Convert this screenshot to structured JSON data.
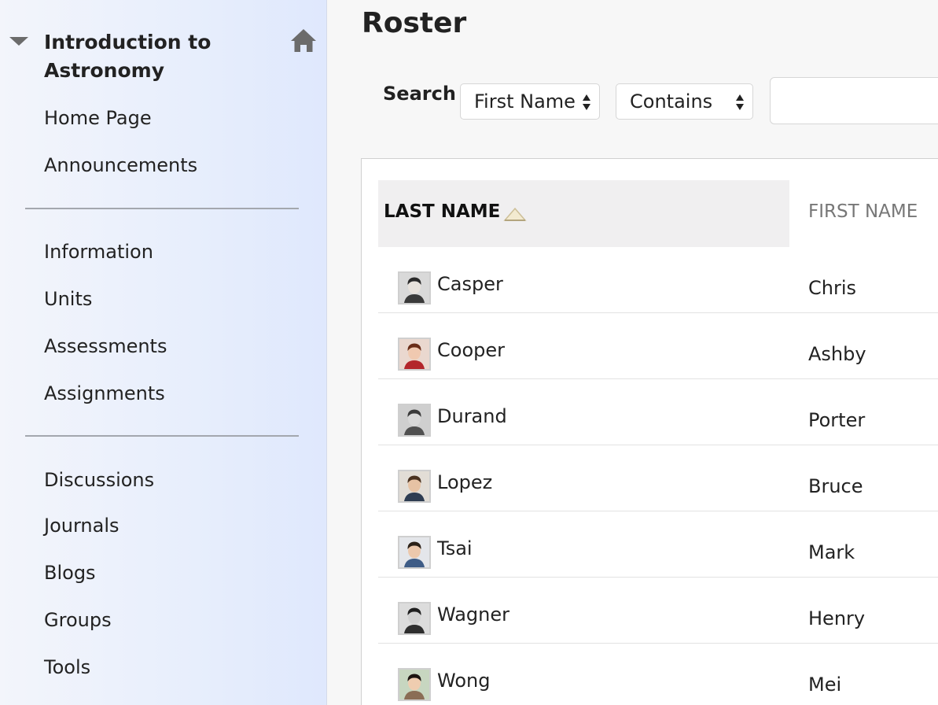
{
  "sidebar": {
    "course_title": "Introduction to Astronomy",
    "groups": [
      [
        "Home Page",
        "Announcements"
      ],
      [
        "Information",
        "Units",
        "Assessments",
        "Assignments"
      ],
      [
        "Discussions",
        "Journals",
        "Blogs",
        "Groups",
        "Tools"
      ]
    ]
  },
  "main": {
    "title": "Roster",
    "search": {
      "label": "Search",
      "field_value": "First Name",
      "operator_value": "Contains",
      "query_value": ""
    },
    "table": {
      "col_last": "LAST NAME",
      "col_first": "FIRST NAME",
      "rows": [
        {
          "last": "Casper",
          "first": "Chris",
          "avatar_bg": "#d9d9d9",
          "hair": "#2a2a2a",
          "skin": "#e8e2dc",
          "shirt": "#3a3a3a"
        },
        {
          "last": "Cooper",
          "first": "Ashby",
          "avatar_bg": "#ead8cf",
          "hair": "#6a2d18",
          "skin": "#f0c9b0",
          "shirt": "#b3262b"
        },
        {
          "last": "Durand",
          "first": "Porter",
          "avatar_bg": "#cfcfcf",
          "hair": "#3a3a3a",
          "skin": "#d8d8d8",
          "shirt": "#505050"
        },
        {
          "last": "Lopez",
          "first": "Bruce",
          "avatar_bg": "#e2ddd6",
          "hair": "#4a3220",
          "skin": "#e6c2a4",
          "shirt": "#2f3d52"
        },
        {
          "last": "Tsai",
          "first": "Mark",
          "avatar_bg": "#e4e6ea",
          "hair": "#2b2118",
          "skin": "#ecc8ac",
          "shirt": "#3e5c86"
        },
        {
          "last": "Wagner",
          "first": "Henry",
          "avatar_bg": "#dcdcdc",
          "hair": "#1e1e1e",
          "skin": "#d0d0d0",
          "shirt": "#2e2e2e"
        },
        {
          "last": "Wong",
          "first": "Mei",
          "avatar_bg": "#c7d6c0",
          "hair": "#1c1410",
          "skin": "#efcdb0",
          "shirt": "#8a6d55"
        }
      ]
    }
  },
  "colors": {
    "sidebar_bg": "#e7eefc",
    "divider": "#a3a7ae",
    "header_bg": "#f0eff0",
    "icon_gray": "#6b6b6b"
  }
}
